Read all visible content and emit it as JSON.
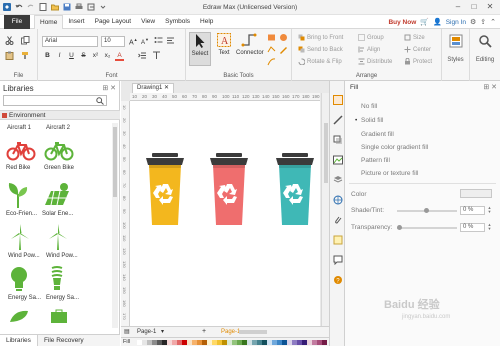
{
  "window": {
    "title": "Edraw Max (Unlicensed Version)"
  },
  "menu": {
    "file": "File",
    "tabs": [
      "Home",
      "Insert",
      "Page Layout",
      "View",
      "Symbols",
      "Help"
    ],
    "buy_now": "Buy Now",
    "sign_in": "Sign In"
  },
  "ribbon": {
    "file_label": "File",
    "font_name": "Arial",
    "font_size": "10",
    "font_label": "Font",
    "format_buttons": [
      "B",
      "I",
      "U",
      "S",
      "x²",
      "x₂",
      "A"
    ],
    "select_label": "Select",
    "text_label": "Text",
    "connector_label": "Connector",
    "basic_tools_label": "Basic Tools",
    "bring_to_front": "Bring to Front",
    "send_to_back": "Send to Back",
    "rotate_flip": "Rotate & Flip",
    "group": "Group",
    "align": "Align",
    "distribute": "Distribute",
    "size": "Size",
    "center": "Center",
    "protect": "Protect",
    "arrange_label": "Arrange",
    "styles_label": "Styles",
    "editing_label": "Editing"
  },
  "libraries": {
    "title": "Libraries",
    "section": "Environment",
    "items": [
      {
        "label": "Aircraft 1"
      },
      {
        "label": "Aircraft 2"
      },
      {
        "label": "Red Bike"
      },
      {
        "label": "Green Bike"
      },
      {
        "label": "Eco-Frien..."
      },
      {
        "label": "Solar Ene..."
      },
      {
        "label": "Wind Pow..."
      },
      {
        "label": "Wind Pow..."
      },
      {
        "label": "Energy Sa..."
      },
      {
        "label": "Energy Sa..."
      }
    ],
    "tabs": [
      "Libraries",
      "File Recovery"
    ]
  },
  "canvas": {
    "doc_tab": "Drawing1",
    "ruler_ticks": [
      "10",
      "20",
      "30",
      "40",
      "50",
      "60",
      "70",
      "80",
      "90",
      "100",
      "110",
      "120",
      "130",
      "140",
      "150",
      "160",
      "170",
      "180",
      "190"
    ],
    "ruler_v_ticks": [
      "10",
      "20",
      "30",
      "40",
      "50",
      "60",
      "70",
      "80",
      "90",
      "100",
      "110",
      "120",
      "130",
      "140",
      "150",
      "160",
      "170"
    ],
    "bins": [
      {
        "color": "#f3b71e",
        "name": "yellow-recycle-bin"
      },
      {
        "color": "#ef6e6e",
        "name": "red-recycle-bin"
      },
      {
        "color": "#3fb8b6",
        "name": "teal-recycle-bin"
      }
    ],
    "page_tab_1": "Page-1",
    "page_tab_2": "Page-1",
    "fill_label": "Fill"
  },
  "fill_panel": {
    "title": "Fill",
    "options": [
      "No fill",
      "Solid fill",
      "Gradient fill",
      "Single color gradient fill",
      "Pattern fill",
      "Picture or texture fill"
    ],
    "selected_option": "Solid fill",
    "color_label": "Color",
    "shade_label": "Shade/Tint:",
    "shade_value": "0 %",
    "transparency_label": "Transparency:",
    "transparency_value": "0 %"
  },
  "watermark": {
    "text": "Baidu 经验",
    "url": "jingyan.baidu.com"
  },
  "colors": {
    "accent": "#e08a00",
    "file_menu": "#3a3a3a",
    "buy_now": "#c0392b"
  }
}
